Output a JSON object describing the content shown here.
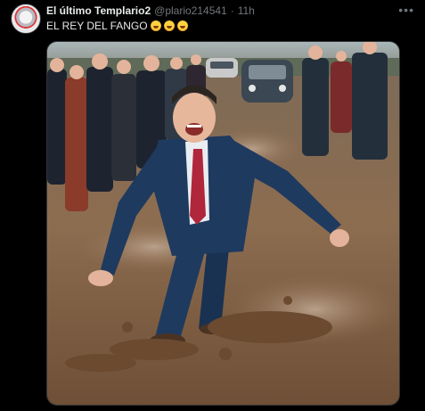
{
  "tweet": {
    "display_name": "El último Templario2",
    "handle": "@plario214541",
    "separator": "·",
    "time": "11h",
    "text": "EL REY DEL FANGO",
    "emojis": [
      "rolling-on-floor-laughing-emoji",
      "rolling-on-floor-laughing-emoji",
      "rolling-on-floor-laughing-emoji"
    ]
  },
  "colors": {
    "background": "#000000",
    "text_primary": "#e7e9ea",
    "text_secondary": "#71767b",
    "suit": "#1f3a5f",
    "tie": "#b0263a",
    "mud": "#8a6a4d"
  },
  "icons": {
    "more": "more-horizontal-icon",
    "avatar": "avatar"
  }
}
